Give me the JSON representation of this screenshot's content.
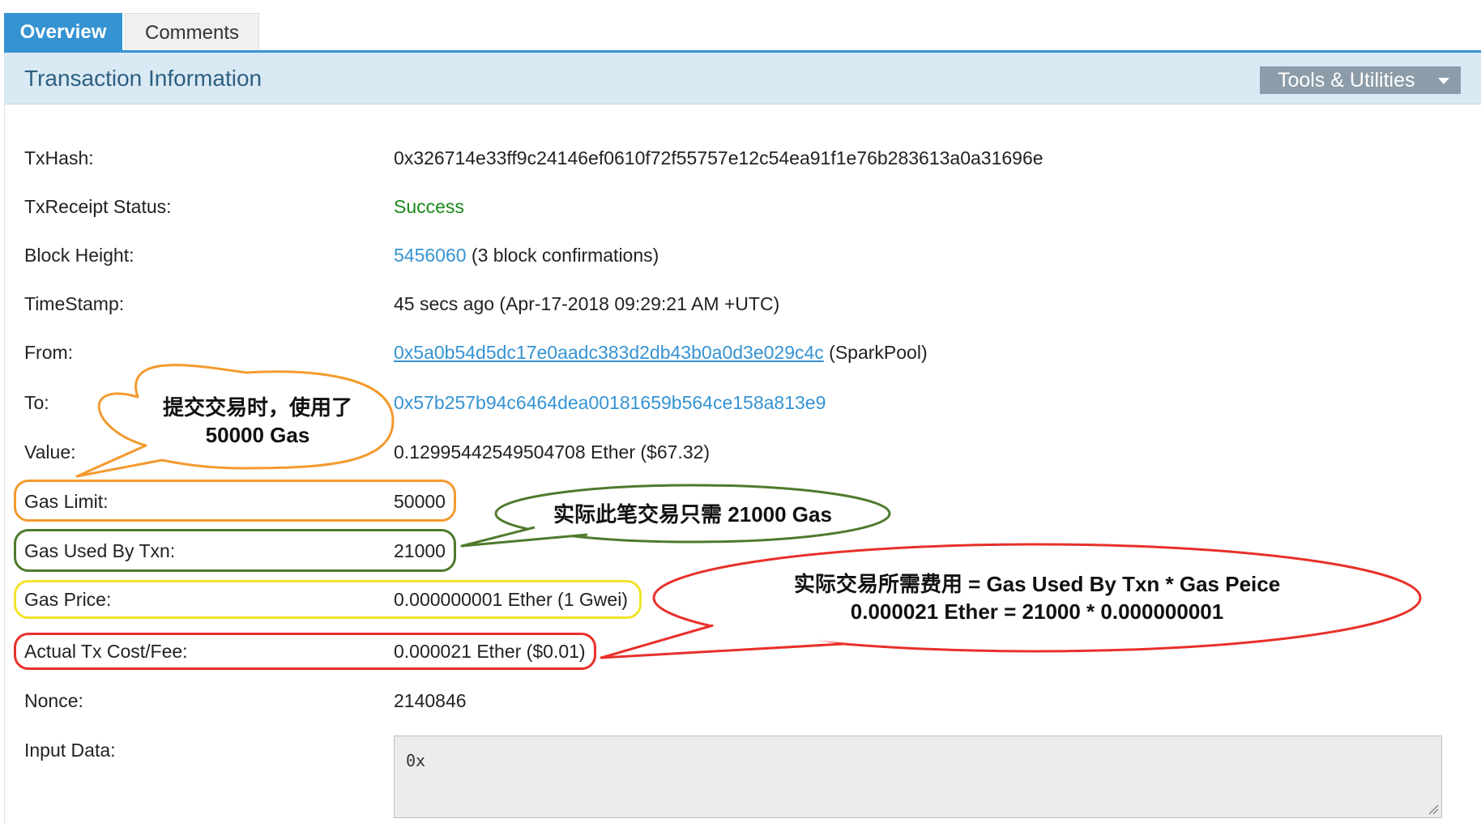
{
  "tabs": [
    {
      "label": "Overview",
      "active": true
    },
    {
      "label": "Comments",
      "active": false
    }
  ],
  "panel": {
    "title": "Transaction Information",
    "tools_label": "Tools & Utilities"
  },
  "rows": {
    "txhash": {
      "label": "TxHash:",
      "value": "0x326714e33ff9c24146ef0610f72f55757e12c54ea91f1e76b283613a0a31696e"
    },
    "status": {
      "label": "TxReceipt Status:",
      "value": "Success"
    },
    "block": {
      "label": "Block Height:",
      "block_number": "5456060",
      "confirmations": " (3 block confirmations)"
    },
    "timestamp": {
      "label": "TimeStamp:",
      "value": "45 secs ago (Apr-17-2018 09:29:21 AM +UTC)"
    },
    "from": {
      "label": "From:",
      "address": "0x5a0b54d5dc17e0aadc383d2db43b0a0d3e029c4c",
      "name": " (SparkPool)"
    },
    "to": {
      "label": "To:",
      "address": "0x57b257b94c6464dea00181659b564ce158a813e9"
    },
    "value": {
      "label": "Value:",
      "value": "0.12995442549504708 Ether ($67.32)"
    },
    "gas_limit": {
      "label": "Gas Limit:",
      "value": "50000"
    },
    "gas_used": {
      "label": "Gas Used By Txn:",
      "value": "21000"
    },
    "gas_price": {
      "label": "Gas Price:",
      "value": "0.000000001 Ether (1 Gwei)"
    },
    "tx_fee": {
      "label": "Actual Tx Cost/Fee:",
      "value": "0.000021 Ether ($0.01)"
    },
    "nonce": {
      "label": "Nonce:",
      "value": "2140846"
    },
    "input": {
      "label": "Input Data:",
      "value": "0x"
    }
  },
  "callouts": {
    "orange_line1": "提交交易时，使用了",
    "orange_line2": "50000 Gas",
    "green": "实际此笔交易只需 21000 Gas",
    "red_line1": "实际交易所需费用 = Gas Used By Txn * Gas Peice",
    "red_line2": "0.000021 Ether = 21000 * 0.000000001"
  },
  "colors": {
    "tab_active": "#3593d2",
    "header_bg": "#d9eaf5",
    "success": "#1a8a1a",
    "link": "#3593d2",
    "orange": "#f39a2e",
    "green": "#4f7a2c",
    "yellow": "#f2e42a",
    "red": "#e8302a"
  }
}
